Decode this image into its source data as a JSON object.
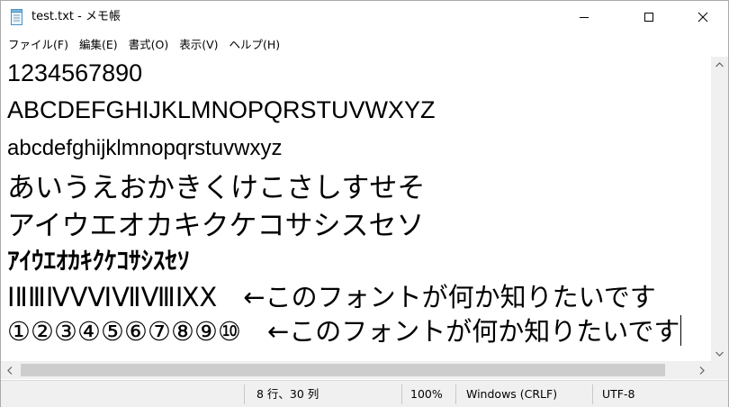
{
  "window": {
    "title": "test.txt - メモ帳"
  },
  "menu": {
    "items": [
      "ファイル(F)",
      "編集(E)",
      "書式(O)",
      "表示(V)",
      "ヘルプ(H)"
    ]
  },
  "editor": {
    "lines": [
      "1234567890",
      "ABCDEFGHIJKLMNOPQRSTUVWXYZ",
      "abcdefghijklmnopqrstuvwxyz",
      "あいうえおかきくけこさしすせそ",
      "アイウエオカキクケコサシスセソ",
      "ｱｲｳｴｵｶｷｸｹｺｻｼｽｾｿ",
      "ⅠⅡⅢⅣⅤⅥⅦⅧⅨⅩ　←このフォントが何か知りたいです",
      "①②③④⑤⑥⑦⑧⑨⑩　←このフォントが何か知りたいです"
    ]
  },
  "status": {
    "position": "8 行、30 列",
    "zoom": "100%",
    "line_ending": "Windows (CRLF)",
    "encoding": "UTF-8"
  },
  "icons": {
    "app": "notepad-icon",
    "minimize": "minimize-icon",
    "maximize": "maximize-icon",
    "close": "close-icon"
  }
}
